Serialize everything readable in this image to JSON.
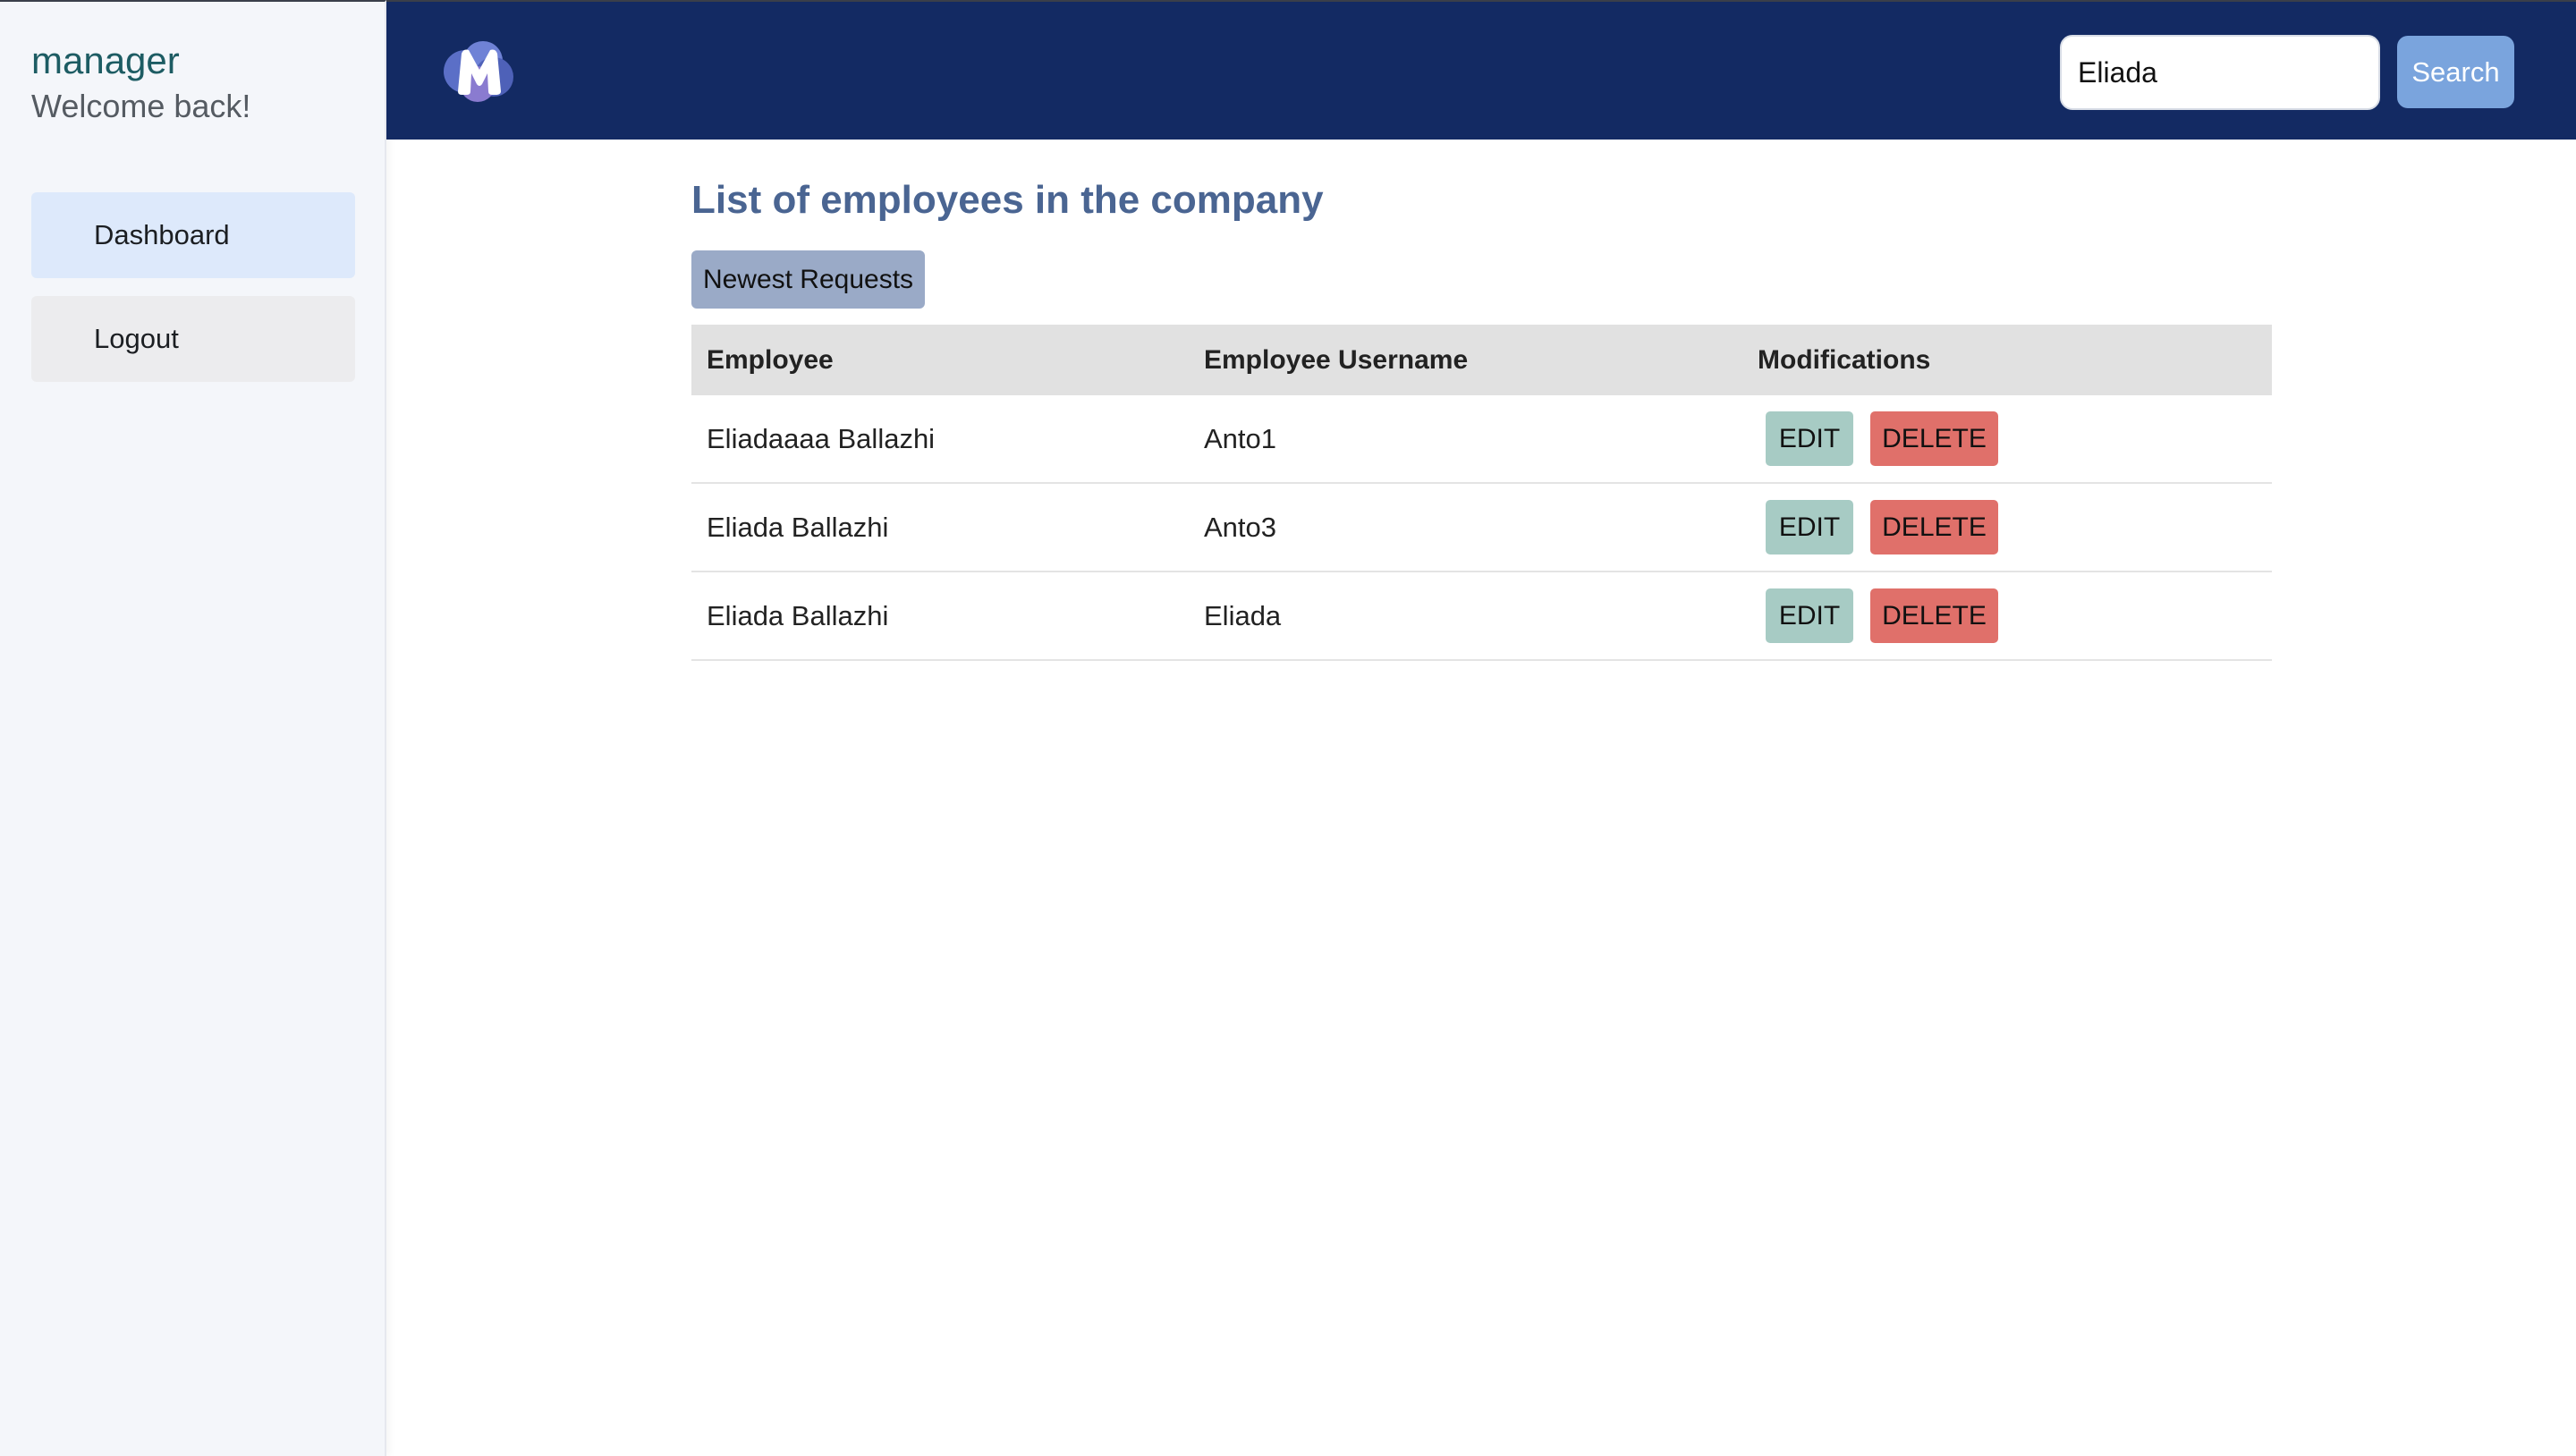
{
  "sidebar": {
    "username": "manager",
    "welcome": "Welcome back!",
    "items": [
      {
        "label": "Dashboard"
      },
      {
        "label": "Logout"
      }
    ]
  },
  "header": {
    "logo_icon": "m-logo-icon",
    "search": {
      "value": "Eliada",
      "button_label": "Search"
    },
    "colors": {
      "background": "#132a63",
      "search_button": "#7aa4dd"
    }
  },
  "main": {
    "title": "List of employees in the company",
    "newest_button": "Newest Requests",
    "table": {
      "columns": [
        "Employee",
        "Employee Username",
        "Modifications"
      ],
      "rows": [
        {
          "employee": "Eliadaaaa Ballazhi",
          "username": "Anto1",
          "edit": "EDIT",
          "delete": "DELETE"
        },
        {
          "employee": "Eliada Ballazhi",
          "username": "Anto3",
          "edit": "EDIT",
          "delete": "DELETE"
        },
        {
          "employee": "Eliada Ballazhi",
          "username": "Eliada",
          "edit": "EDIT",
          "delete": "DELETE"
        }
      ]
    },
    "colors": {
      "title": "#4a6592",
      "edit_button": "#a7cbc4",
      "delete_button": "#e0706a"
    }
  }
}
